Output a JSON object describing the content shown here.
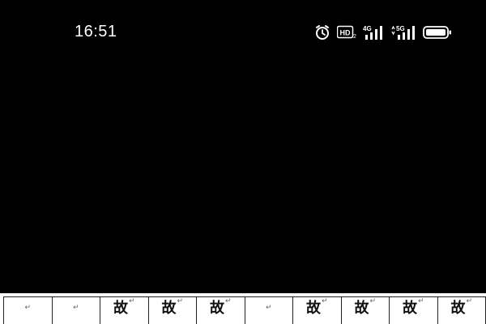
{
  "status_bar": {
    "time": "16:51",
    "hd_label": "HD",
    "hd_sub": "2",
    "network_1": "4G",
    "network_2": "5G",
    "icons": [
      "alarm-icon",
      "hd-voice-icon",
      "signal-4g-icon",
      "signal-5g-icon",
      "battery-icon"
    ]
  },
  "document": {
    "cells": [
      {
        "text": "",
        "mark": "↵"
      },
      {
        "text": "",
        "mark": "↵"
      },
      {
        "text": "故",
        "mark": "↵"
      },
      {
        "text": "故",
        "mark": "↵"
      },
      {
        "text": "故",
        "mark": "↵"
      },
      {
        "text": "",
        "mark": "↵"
      },
      {
        "text": "故",
        "mark": "↵"
      },
      {
        "text": "故",
        "mark": "↵"
      },
      {
        "text": "故",
        "mark": "↵"
      },
      {
        "text": "故",
        "mark": "↵"
      }
    ]
  },
  "colors": {
    "background": "#000000",
    "status_text": "#ffffff",
    "document_bg": "#ffffff"
  }
}
